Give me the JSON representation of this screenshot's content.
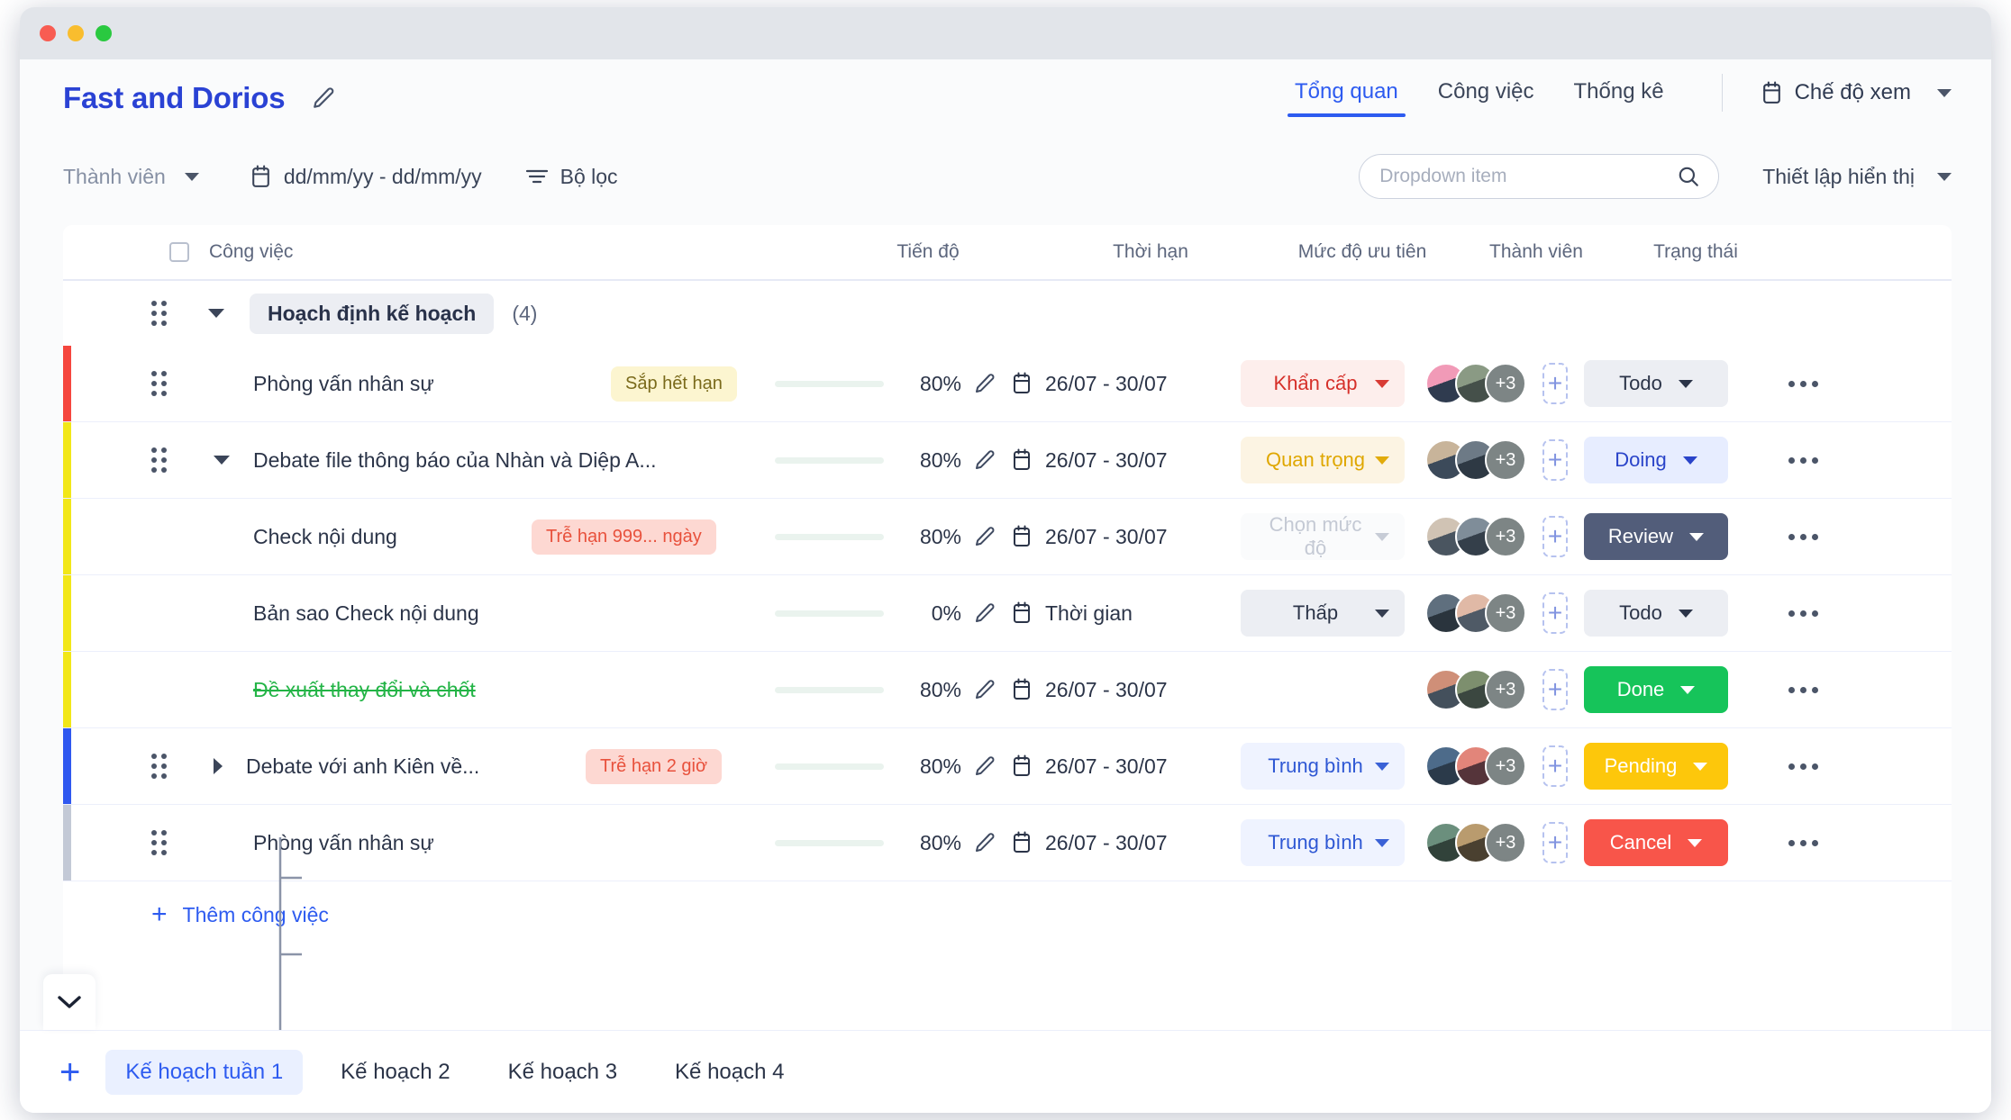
{
  "window": {
    "dots": [
      "close",
      "minimize",
      "maximize"
    ]
  },
  "header": {
    "project_title": "Fast and Dorios",
    "edit_icon": "pencil-icon",
    "tabs": [
      {
        "label": "Tổng quan",
        "active": true
      },
      {
        "label": "Công việc",
        "active": false
      },
      {
        "label": "Thống kê",
        "active": false
      }
    ],
    "view_mode": {
      "label": "Chế độ xem",
      "icon": "calendar-icon"
    }
  },
  "filters": {
    "member": {
      "label": "Thành viên",
      "icon": "chevron-down-icon"
    },
    "date_range": {
      "label": "dd/mm/yy - dd/mm/yy",
      "icon": "calendar-icon"
    },
    "filter": {
      "label": "Bộ lọc",
      "icon": "filter-icon"
    },
    "search": {
      "placeholder": "Dropdown item",
      "value": "",
      "icon": "search-icon"
    },
    "display_settings": {
      "label": "Thiết lập hiển thị",
      "icon": "chevron-down-icon"
    }
  },
  "table": {
    "columns": {
      "checkbox": "checkbox-icon",
      "task": "Công việc",
      "progress": "Tiến độ",
      "due": "Thời hạn",
      "priority": "Mức độ ưu tiên",
      "member": "Thành viên",
      "status": "Trạng thái"
    },
    "group": {
      "name": "Hoạch định kế hoạch",
      "count": "(4)",
      "expanded": true
    },
    "add_task_label": "Thêm công việc",
    "rows": [
      {
        "name": "Phòng vấn nhân sự",
        "indent": 0,
        "toggle": "none",
        "strike": false,
        "badge": {
          "text": "Sắp hết hạn",
          "kind": "warn"
        },
        "progress": 80,
        "progress_label": "80%",
        "due": "26/07 - 30/07",
        "due_icon": "calendar-icon",
        "priority": {
          "label": "Khẩn cấp",
          "kind": "urgent"
        },
        "members_more": "+3",
        "status": {
          "label": "Todo",
          "kind": "todo"
        },
        "bar_color": "#f5463e"
      },
      {
        "name": "Debate file thông báo của Nhàn và Diệp A...",
        "indent": 0,
        "toggle": "expanded",
        "strike": false,
        "badge": null,
        "progress": 80,
        "progress_label": "80%",
        "due": "26/07 - 30/07",
        "due_icon": "calendar-icon",
        "priority": {
          "label": "Quan trọng",
          "kind": "imp"
        },
        "members_more": "+3",
        "status": {
          "label": "Doing",
          "kind": "doing"
        },
        "bar_color": "#f2e718"
      },
      {
        "name": "Check nội dung",
        "indent": 1,
        "toggle": "none",
        "strike": false,
        "badge": {
          "text": "Trễ hạn 999... ngày",
          "kind": "late"
        },
        "progress": 80,
        "progress_label": "80%",
        "due": "26/07 - 30/07",
        "due_icon": "calendar-icon",
        "priority": {
          "label": "Chọn mức độ",
          "kind": "none"
        },
        "members_more": "+3",
        "status": {
          "label": "Review",
          "kind": "review"
        },
        "bar_color": "#f2e718"
      },
      {
        "name": "Bản sao Check nội dung",
        "indent": 1,
        "toggle": "none",
        "strike": false,
        "badge": null,
        "progress": 0,
        "progress_label": "0%",
        "due": "Thời gian",
        "due_icon": "calendar-icon",
        "priority": {
          "label": "Thấp",
          "kind": "low"
        },
        "members_more": "+3",
        "status": {
          "label": "Todo",
          "kind": "todo"
        },
        "bar_color": "#f2e718"
      },
      {
        "name": "Đề xuất thay đổi và chốt",
        "indent": 1,
        "toggle": "none",
        "strike": true,
        "badge": null,
        "progress": 80,
        "progress_label": "80%",
        "due": "26/07 - 30/07",
        "due_icon": "calendar-icon",
        "priority": {
          "label": "",
          "kind": "blank"
        },
        "members_more": "+3",
        "status": {
          "label": "Done",
          "kind": "done"
        },
        "bar_color": "#f2e718"
      },
      {
        "name": "Debate với anh Kiên về...",
        "indent": 0,
        "toggle": "collapsed",
        "strike": false,
        "badge": {
          "text": "Trễ hạn 2 giờ",
          "kind": "late"
        },
        "progress": 80,
        "progress_label": "80%",
        "due": "26/07 - 30/07",
        "due_icon": "calendar-icon",
        "priority": {
          "label": "Trung bình",
          "kind": "med"
        },
        "members_more": "+3",
        "status": {
          "label": "Pending",
          "kind": "pending"
        },
        "bar_color": "#2f58f0"
      },
      {
        "name": "Phòng vấn nhân sự",
        "indent": 0,
        "toggle": "none",
        "strike": false,
        "badge": null,
        "progress": 80,
        "progress_label": "80%",
        "due": "26/07 - 30/07",
        "due_icon": "calendar-icon",
        "priority": {
          "label": "Trung bình",
          "kind": "med"
        },
        "members_more": "+3",
        "status": {
          "label": "Cancel",
          "kind": "cancel"
        },
        "bar_color": "#c3c9d6"
      }
    ]
  },
  "bottom": {
    "collapse_icon": "chevron-down-icon",
    "add_icon": "plus-icon",
    "tabs": [
      {
        "label": "Kế hoạch tuần 1",
        "active": true
      },
      {
        "label": "Kế hoạch 2",
        "active": false
      },
      {
        "label": "Kế hoạch 3",
        "active": false
      },
      {
        "label": "Kế hoạch 4",
        "active": false
      }
    ]
  },
  "colors": {
    "accent": "#2d5bf0",
    "title": "#2a42d4",
    "progress_green": "#1e9e42",
    "urgent": "#d6302a",
    "important": "#dfa700"
  }
}
